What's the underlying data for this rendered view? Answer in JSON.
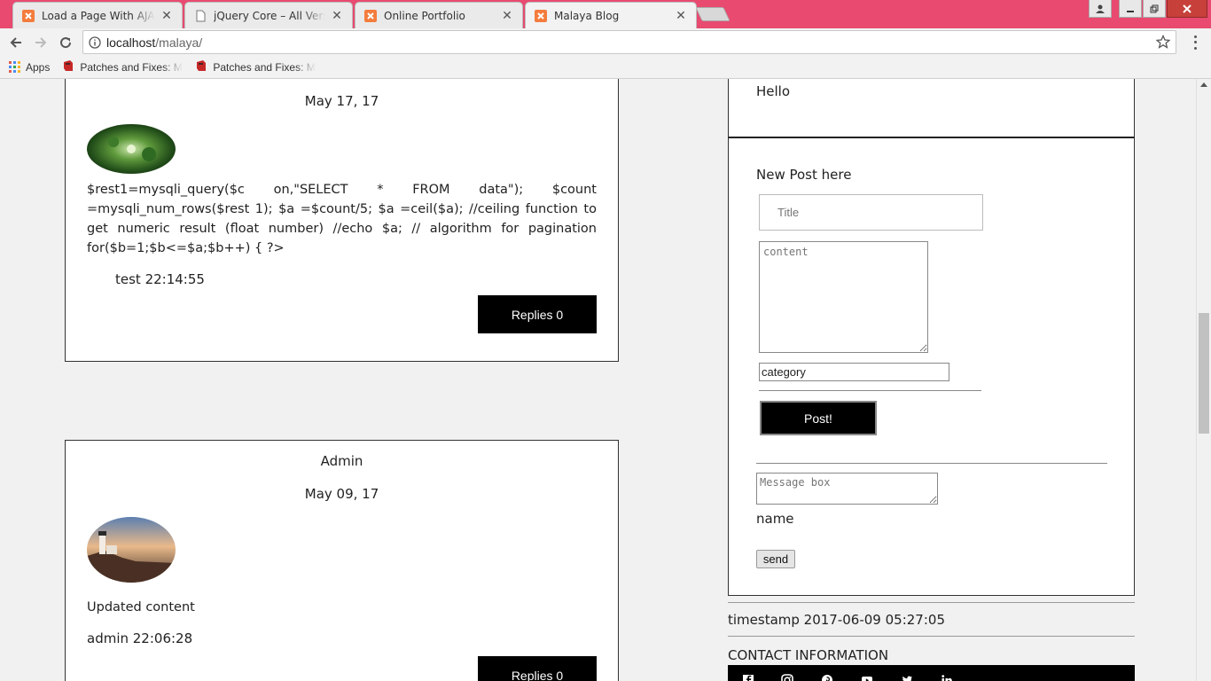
{
  "browser": {
    "tabs": [
      {
        "title": "Load a Page With AJAX a",
        "icon": "xampp-icon"
      },
      {
        "title": "jQuery Core – All Version",
        "icon": "document-icon"
      },
      {
        "title": "Online Portfolio",
        "icon": "xampp-icon"
      },
      {
        "title": "Malaya Blog",
        "icon": "xampp-icon",
        "active": true
      }
    ],
    "url_host": "localhost",
    "url_path": "/malaya/",
    "bookmarks": [
      {
        "title": "Apps",
        "icon": "apps-grid-icon"
      },
      {
        "title": "Patches and Fixes: Me",
        "icon": "patch-icon"
      },
      {
        "title": "Patches and Fixes: Me",
        "icon": "patch-icon"
      }
    ]
  },
  "posts": [
    {
      "author": "",
      "date": "May 17, 17",
      "body": "$rest1=mysqli_query($c on,\"SELECT * FROM data\"); $count =mysqli_num_rows($rest 1); $a =$count/5; $a =ceil($a); //ceiling function to get numeric result (float number) //echo $a; // algorithm for pagination for($b=1;$b<=$a;$b++) { ?>",
      "meta": "test 22:14:55",
      "replies_label": "Replies 0"
    },
    {
      "author": "Admin",
      "date": "May 09, 17",
      "body": "Updated content",
      "meta": "admin 22:06:28",
      "replies_label": "Replies 0"
    }
  ],
  "sidebar": {
    "greeting": "Hello",
    "new_post_heading": "New Post here",
    "title_placeholder": "Title",
    "content_placeholder": "content",
    "category_value": "category",
    "post_button": "Post!",
    "message_placeholder": "Message box",
    "name_label": "name",
    "send_button": "send",
    "timestamp": "timestamp 2017-06-09 05:27:05",
    "contact_heading": "CONTACT INFORMATION",
    "social_icons": [
      "facebook-icon",
      "instagram-icon",
      "pinterest-icon",
      "youtube-icon",
      "twitter-icon",
      "linkedin-icon"
    ]
  },
  "colors": {
    "tab_strip": "#e84a70",
    "xampp_orange": "#f47c3c",
    "button_black": "#000000"
  }
}
